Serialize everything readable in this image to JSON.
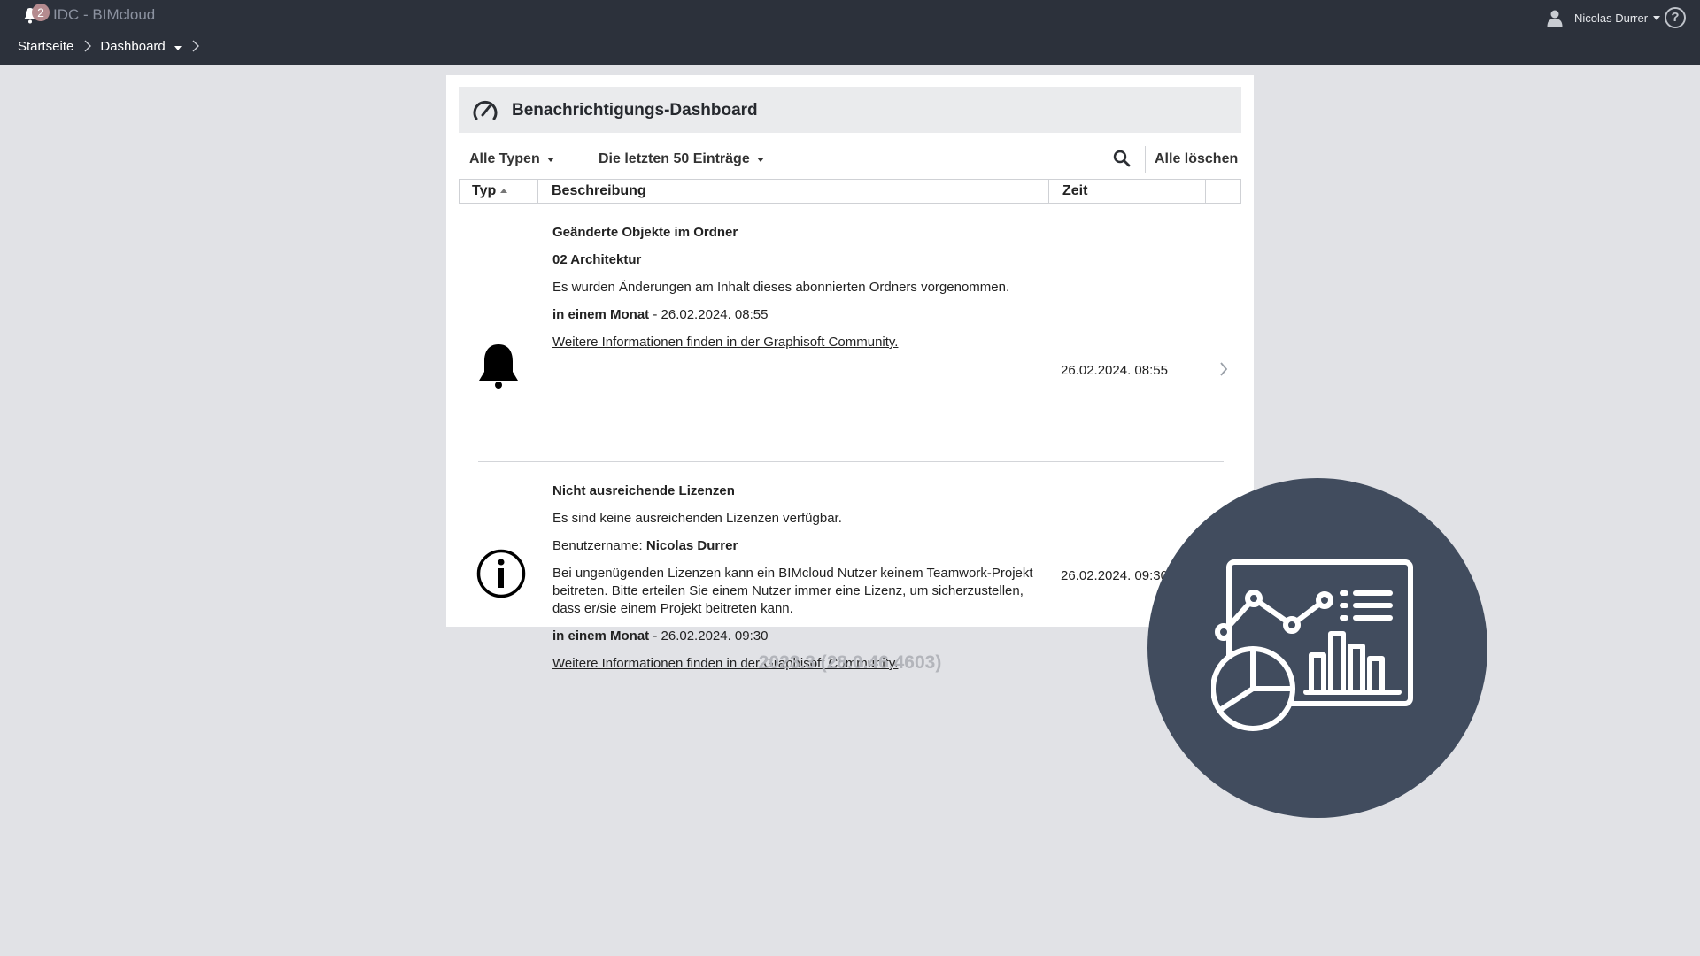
{
  "topbar": {
    "notification_count": "2",
    "app_title": "IDC - BIMcloud",
    "breadcrumb": [
      "Startseite",
      "Dashboard"
    ],
    "user_name": "Nicolas Durrer",
    "help_label": "?"
  },
  "panel": {
    "title": "Benachrichtigungs-Dashboard",
    "filter_type": "Alle Typen",
    "filter_range": "Die letzten 50 Einträge",
    "clear_all": "Alle löschen",
    "columns": [
      "Typ",
      "Beschreibung",
      "Zeit"
    ]
  },
  "notifications": [
    {
      "icon": "bell-icon",
      "title": "Geänderte Objekte im Ordner",
      "folder": "02 Architektur",
      "message": "Es wurden Änderungen am Inhalt dieses abonnierten Ordners vorgenommen.",
      "expiry_label": "in einem Monat",
      "expiry_rest": " - 26.02.2024. 08:55",
      "link": "Weitere Informationen finden in der Graphisoft Community.",
      "time": "26.02.2024. 08:55"
    },
    {
      "icon": "info-icon",
      "title": "Nicht ausreichende Lizenzen",
      "message": "Es sind keine ausreichenden Lizenzen verfügbar.",
      "user_label": "Benutzername: ",
      "user_value": "Nicolas Durrer",
      "detail": "Bei ungenügenden Lizenzen kann ein BIMcloud Nutzer keinem Teamwork-Projekt beitreten. Bitte erteilen Sie einem Nutzer immer eine Lizenz, um sicherzustellen, dass er/sie einem Projekt beitreten kann.",
      "expiry_label": "in einem Monat",
      "expiry_rest": " - 26.02.2024. 09:30",
      "link": "Weitere Informationen finden in der Graphisoft Community.",
      "time": "26.02.2024. 09:30"
    }
  ],
  "version": "2023.3 (28.0.46.4603)",
  "overlay_icon": "dashboard-analytics-icon",
  "colors": {
    "topbar": "#2c313b",
    "background": "#e1e2e6",
    "panel": "#ffffff",
    "overlay_circle": "#414c5e"
  }
}
